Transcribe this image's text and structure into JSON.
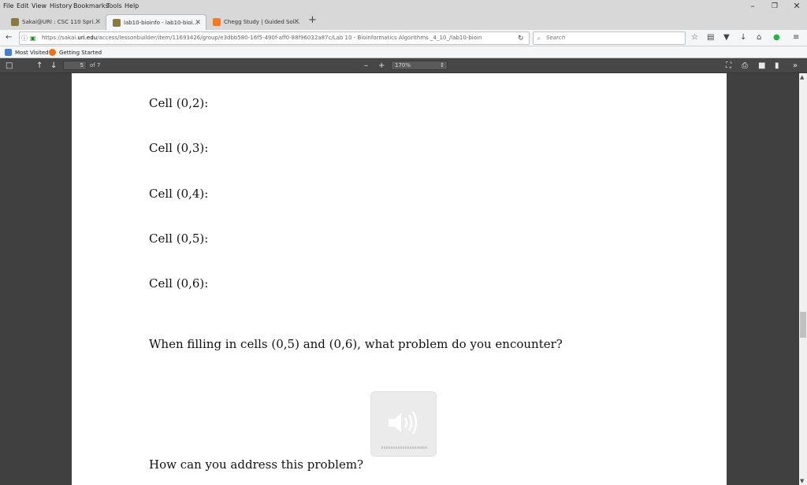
{
  "menu": {
    "items": [
      "File",
      "Edit",
      "View",
      "History",
      "Bookmarks",
      "Tools",
      "Help"
    ]
  },
  "window_controls": {
    "minimize": "–",
    "maximize": "❐",
    "close": "✕"
  },
  "tabs": [
    {
      "label": "Sakai@URI : CSC 110 Spri...",
      "active": false,
      "icon": "sakai-icon"
    },
    {
      "label": "lab10-bioinfo - lab10-bioi...",
      "active": true,
      "icon": "sakai-icon"
    },
    {
      "label": "Chegg Study | Guided Sol...",
      "active": false,
      "icon": "chegg-icon"
    }
  ],
  "tab_close": "✕",
  "new_tab": "+",
  "nav": {
    "url_prefix": "https://sakai.",
    "url_domain": "uri.edu",
    "url_rest": "/access/lessonbuilder/item/11693426/group/e3dbb580-16f5-490f-aff0-88f96032a87c/Lab 10 - Bioinformatics Algorithms _4_10_/lab10-bioin",
    "search_placeholder": "Search"
  },
  "bookmarks": [
    {
      "label": "Most Visited",
      "icon": "most-visited-icon"
    },
    {
      "label": "Getting Started",
      "icon": "firefox-icon"
    }
  ],
  "pdf_toolbar": {
    "page_number": "5",
    "page_count": "of 7",
    "zoom": "170%",
    "zoom_out": "–",
    "zoom_in": "+"
  },
  "document": {
    "lines": [
      "Cell (0,2):",
      "Cell (0,3):",
      "Cell (0,4):",
      "Cell (0,5):",
      "Cell (0,6):",
      "When filling in cells (0,5) and (0,6), what problem do you encounter?",
      "How can you address this problem?"
    ]
  },
  "colors": {
    "chegg": "#f47b20",
    "sakai": "#8a7a3e",
    "pdf_toolbar": "#474747",
    "viewer_bg": "#404040"
  }
}
